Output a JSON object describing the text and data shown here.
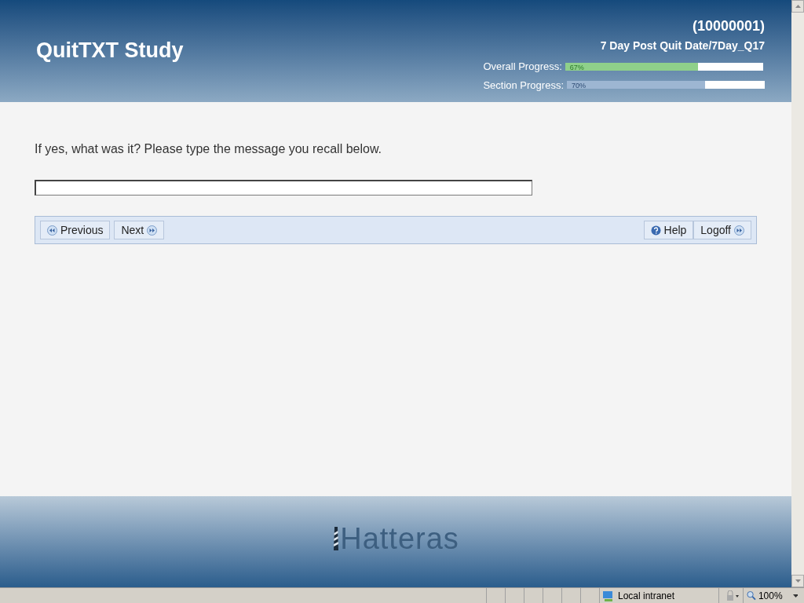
{
  "header": {
    "title": "QuitTXT Study",
    "participant_id": "(10000001)",
    "section": "7 Day Post Quit Date/7Day_Q17",
    "progress": [
      {
        "label": "Overall Progress:",
        "reading": "67%",
        "level": 0.67,
        "kind": "overall"
      },
      {
        "label": "Section Progress:",
        "reading": "70%",
        "level": 0.7,
        "kind": "section"
      }
    ]
  },
  "question": {
    "text": "If yes, what was it? Please type the message you recall below."
  },
  "nav": {
    "left": [
      {
        "label": "Previous",
        "kind": "back"
      },
      {
        "label": "Next",
        "kind": "forward"
      }
    ],
    "right": [
      {
        "label": "Help",
        "kind": "help"
      },
      {
        "label": "Logoff",
        "kind": "forward"
      }
    ]
  },
  "footer": {
    "logo": "Hatteras"
  },
  "status_bar": {
    "zone": "Local intranet",
    "zoom": "100%"
  }
}
